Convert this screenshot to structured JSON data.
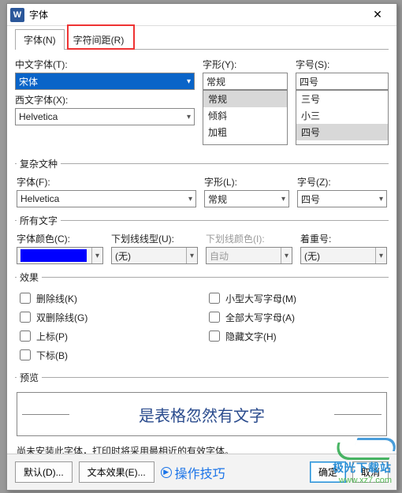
{
  "title": "字体",
  "tabs": {
    "font": "字体(N)",
    "spacing": "字符间距(R)"
  },
  "labels": {
    "cn_font": "中文字体(T):",
    "style": "字形(Y):",
    "size": "字号(S):",
    "west_font": "西文字体(X):",
    "complex_group": "复杂文种",
    "complex_font": "字体(F):",
    "complex_style": "字形(L):",
    "complex_size": "字号(Z):",
    "alltext_group": "所有文字",
    "font_color": "字体颜色(C):",
    "underline_type": "下划线线型(U):",
    "underline_color": "下划线颜色(I):",
    "emphasis": "着重号:",
    "effects_group": "效果",
    "preview_group": "预览"
  },
  "values": {
    "cn_font": "宋体",
    "style": "常规",
    "size": "四号",
    "style_options": [
      "常规",
      "倾斜",
      "加粗"
    ],
    "size_options": [
      "三号",
      "小三",
      "四号"
    ],
    "west_font": "Helvetica",
    "complex_font": "Helvetica",
    "complex_style": "常规",
    "complex_size": "四号",
    "underline_type": "(无)",
    "underline_color": "自动",
    "emphasis": "(无)",
    "color_hex": "#0000ff"
  },
  "effects": {
    "strike": "删除线(K)",
    "dstrike": "双删除线(G)",
    "superscript": "上标(P)",
    "subscript": "下标(B)",
    "smallcaps": "小型大写字母(M)",
    "allcaps": "全部大写字母(A)",
    "hidden": "隐藏文字(H)"
  },
  "preview_text": "是表格忽然有文字",
  "note": "尚未安装此字体，打印时将采用最相近的有效字体。",
  "buttons": {
    "default": "默认(D)...",
    "texteffects": "文本效果(E)...",
    "tips": "操作技巧",
    "ok": "确定",
    "cancel": "取消"
  },
  "watermark": {
    "line1": "极光下载站",
    "line2": "www.xz7.com"
  }
}
